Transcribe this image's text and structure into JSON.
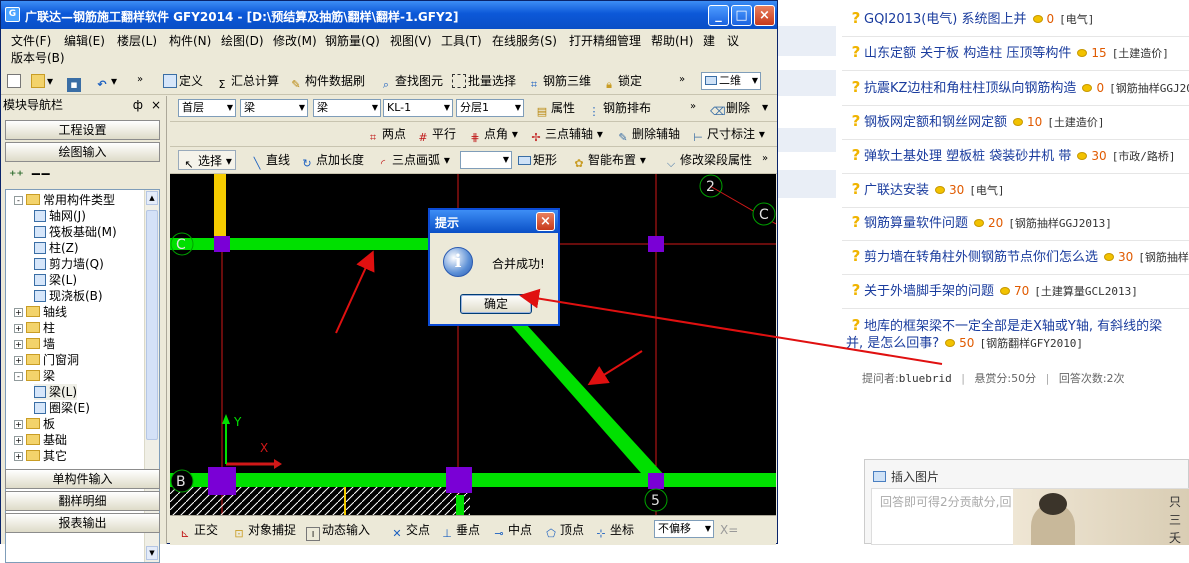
{
  "window": {
    "title": "广联达—钢筋施工翻样软件 GFY2014 - [D:\\预结算及抽筋\\翻样\\翻样-1.GFY2]",
    "minimize_icon": "minimize-icon",
    "maximize_icon": "maximize-icon",
    "close_icon": "close-icon"
  },
  "menu": [
    "文件(F)",
    "编辑(E)",
    "楼层(L)",
    "构件(N)",
    "绘图(D)",
    "修改(M)",
    "钢筋量(Q)",
    "视图(V)",
    "工具(T)",
    "在线服务(S)",
    "打开精细管理",
    "帮助(H)",
    "建",
    "议",
    "版本号(B)"
  ],
  "toolbar1": {
    "items": [
      "定义",
      "汇总计算",
      "构件数据刷",
      "查找图元",
      "批量选择",
      "钢筋三维",
      "锁定"
    ],
    "view_mode": "二维"
  },
  "toolbar2": {
    "floor": "首层",
    "type": "梁",
    "subtype": "梁",
    "name": "KL-1",
    "layer": "分层1",
    "items": [
      "属性",
      "钢筋排布",
      "删除"
    ]
  },
  "toolbar3": {
    "items": [
      "两点",
      "平行",
      "点角",
      "三点辅轴",
      "删除辅轴",
      "尺寸标注"
    ]
  },
  "toolbar4": {
    "items": [
      "选择",
      "直线",
      "点加长度",
      "三点画弧",
      "矩形",
      "智能布置",
      "修改梁段属性"
    ]
  },
  "leftpanel": {
    "header": "模块导航栏",
    "pin": "ф",
    "close": "×",
    "buttons_top": [
      "工程设置",
      "绘图输入"
    ],
    "buttons_bottom": [
      "单构件输入",
      "翻样明细",
      "报表输出"
    ],
    "tree": [
      {
        "label": "常用构件类型",
        "kind": "folder",
        "expand": "-",
        "level": 0
      },
      {
        "label": "轴网(J)",
        "kind": "item",
        "level": 1
      },
      {
        "label": "筏板基础(M)",
        "kind": "item",
        "level": 1
      },
      {
        "label": "柱(Z)",
        "kind": "item",
        "level": 1
      },
      {
        "label": "剪力墙(Q)",
        "kind": "item",
        "level": 1
      },
      {
        "label": "梁(L)",
        "kind": "item",
        "level": 1
      },
      {
        "label": "现浇板(B)",
        "kind": "item",
        "level": 1
      },
      {
        "label": "轴线",
        "kind": "folder",
        "expand": "+",
        "level": 0
      },
      {
        "label": "柱",
        "kind": "folder",
        "expand": "+",
        "level": 0
      },
      {
        "label": "墙",
        "kind": "folder",
        "expand": "+",
        "level": 0
      },
      {
        "label": "门窗洞",
        "kind": "folder",
        "expand": "+",
        "level": 0
      },
      {
        "label": "梁",
        "kind": "folder",
        "expand": "-",
        "level": 0
      },
      {
        "label": "梁(L)",
        "kind": "item",
        "level": 1
      },
      {
        "label": "圈梁(E)",
        "kind": "item",
        "level": 1
      },
      {
        "label": "板",
        "kind": "folder",
        "expand": "+",
        "level": 0
      },
      {
        "label": "基础",
        "kind": "folder",
        "expand": "+",
        "level": 0
      },
      {
        "label": "其它",
        "kind": "folder",
        "expand": "+",
        "level": 0
      }
    ]
  },
  "canvas": {
    "axis_labels": [
      "2",
      "C",
      "C",
      "B",
      "5"
    ],
    "y_label": "Y",
    "x_label": "X"
  },
  "statusbar": {
    "items": [
      "正交",
      "对象捕捉",
      "动态输入",
      "交点",
      "垂点",
      "中点",
      "顶点",
      "坐标"
    ],
    "offset": "不偏移",
    "x_label": "X="
  },
  "dialog": {
    "title": "提示",
    "message": "合并成功!",
    "ok": "确定",
    "icon": "info-icon"
  },
  "questions": [
    {
      "title": "GQI2013(电气) 系统图上并",
      "points": "0",
      "category": "[电气]"
    },
    {
      "title": "山东定额 关于板 构造柱 压顶等构件",
      "points": "15",
      "category": "[土建造价]"
    },
    {
      "title": "抗震KZ边柱和角柱柱顶纵向钢筋构造",
      "points": "0",
      "category": "[钢筋抽样GGJ2013]"
    },
    {
      "title": "钢板网定额和钢丝网定额",
      "points": "10",
      "category": "[土建造价]"
    },
    {
      "title": "弹软土基处理 塑板桩 袋装砂井机 带",
      "points": "30",
      "category": "[市政/路桥]"
    },
    {
      "title": "广联达安装",
      "points": "30",
      "category": "[电气]"
    },
    {
      "title": "钢筋算量软件问题",
      "points": "20",
      "category": "[钢筋抽样GGJ2013]"
    },
    {
      "title": "剪力墙在转角柱外侧钢筋节点你们怎么选",
      "points": "30",
      "category": "[钢筋抽样GGJ2013]"
    },
    {
      "title": "关于外墙脚手架的问题",
      "points": "70",
      "category": "[土建算量GCL2013]"
    }
  ],
  "current_question": {
    "title_line1": "地库的框架梁不一定全部是走X轴或Y轴, 有斜线的梁",
    "title_line2": "并, 是怎么回事?",
    "points": "50",
    "category": "[钢筋翻样GFY2010]",
    "asker_label": "提问者:",
    "asker": "bluebrid",
    "reward": "悬赏分:50分",
    "answers": "回答次数:2次"
  },
  "answer": {
    "insert_image": "插入图片",
    "placeholder": "回答即可得2分贡献分,回",
    "painting_text": [
      "只",
      "三",
      "夭"
    ]
  },
  "colors": {
    "beam": "#00e000",
    "column": "#7a00d6",
    "axis": "#d11818",
    "canvas": "#000000",
    "arrow": "#e01010",
    "titlebar": "#0a4fc6",
    "highlight_beam": "#f5cc00"
  }
}
